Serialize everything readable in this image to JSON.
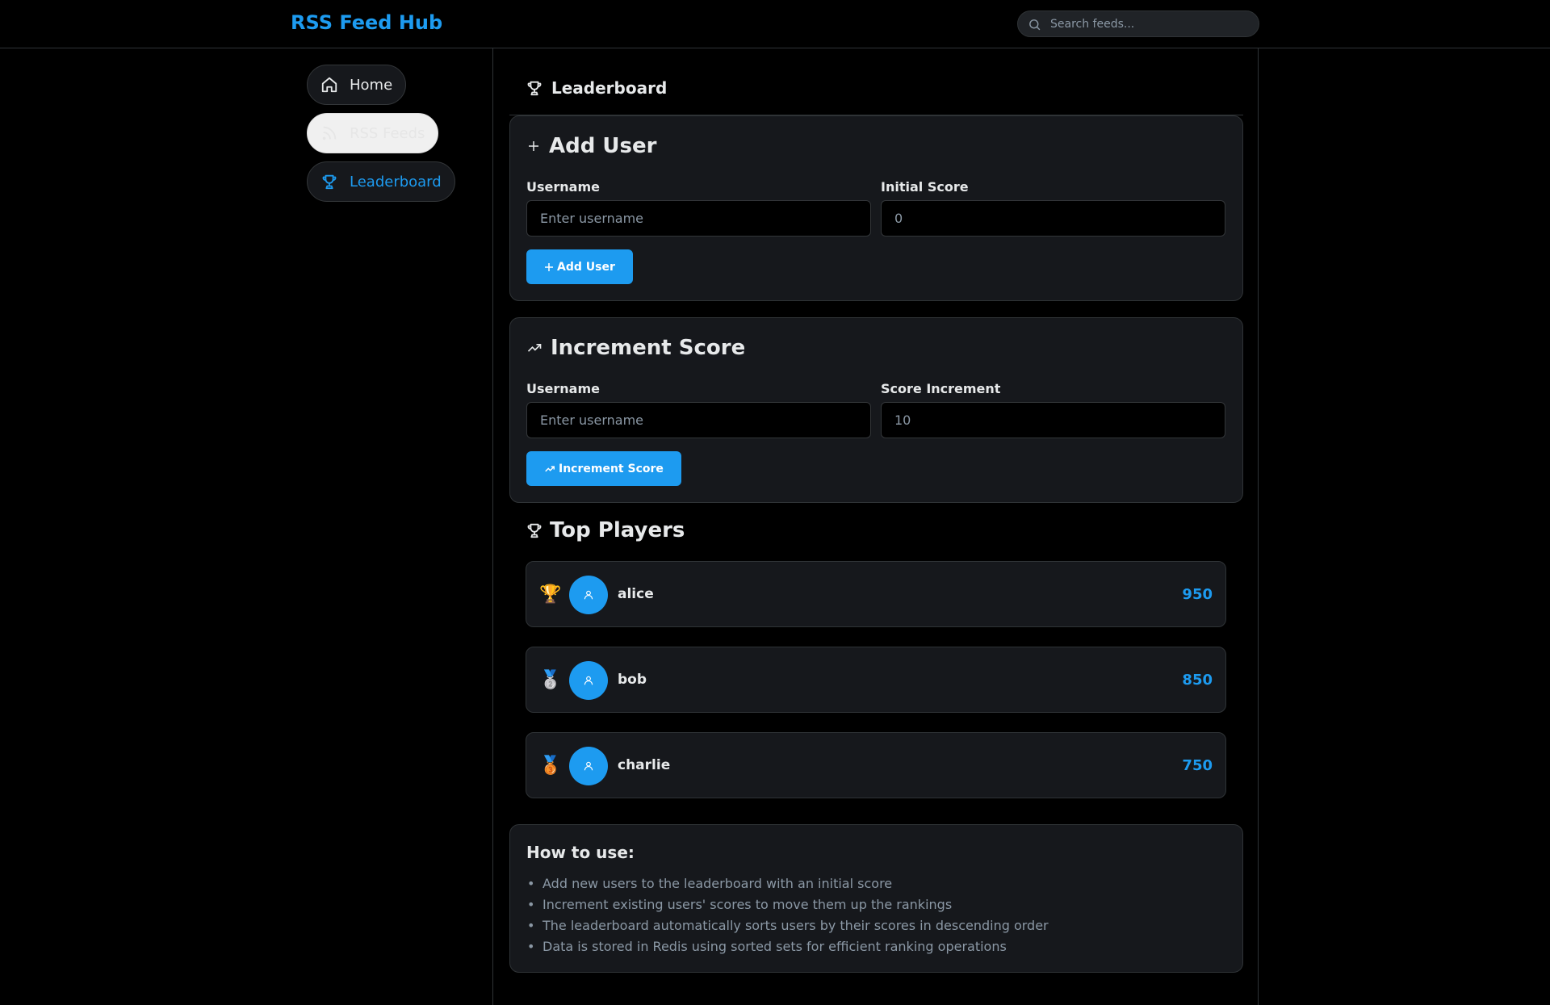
{
  "app": {
    "brand": "RSS Feed Hub"
  },
  "search": {
    "placeholder": "Search feeds..."
  },
  "sidebar": {
    "items": [
      {
        "label": "Home",
        "icon": "home-icon"
      },
      {
        "label": "RSS Feeds",
        "icon": "rss-icon"
      },
      {
        "label": "Leaderboard",
        "icon": "trophy-icon",
        "active": true
      }
    ]
  },
  "page": {
    "title": "Leaderboard"
  },
  "add_user": {
    "title": "Add User",
    "username_label": "Username",
    "username_placeholder": "Enter username",
    "score_label": "Initial Score",
    "score_placeholder": "0",
    "button_label": "Add User"
  },
  "increment": {
    "title": "Increment Score",
    "username_label": "Username",
    "username_placeholder": "Enter username",
    "score_label": "Score Increment",
    "score_placeholder": "10",
    "button_label": "Increment Score"
  },
  "top_players": {
    "title": "Top Players",
    "players": [
      {
        "medal": "🏆",
        "name": "alice",
        "score": "950"
      },
      {
        "medal": "🥈",
        "name": "bob",
        "score": "850"
      },
      {
        "medal": "🥉",
        "name": "charlie",
        "score": "750"
      }
    ]
  },
  "howto": {
    "title": "How to use:",
    "items": [
      "Add new users to the leaderboard with an initial score",
      "Increment existing users' scores to move them up the rankings",
      "The leaderboard automatically sorts users by their scores in descending order",
      "Data is stored in Redis using sorted sets for efficient ranking operations"
    ]
  },
  "colors": {
    "accent": "#1d9bf0",
    "background": "#000000",
    "card": "#16181c"
  }
}
